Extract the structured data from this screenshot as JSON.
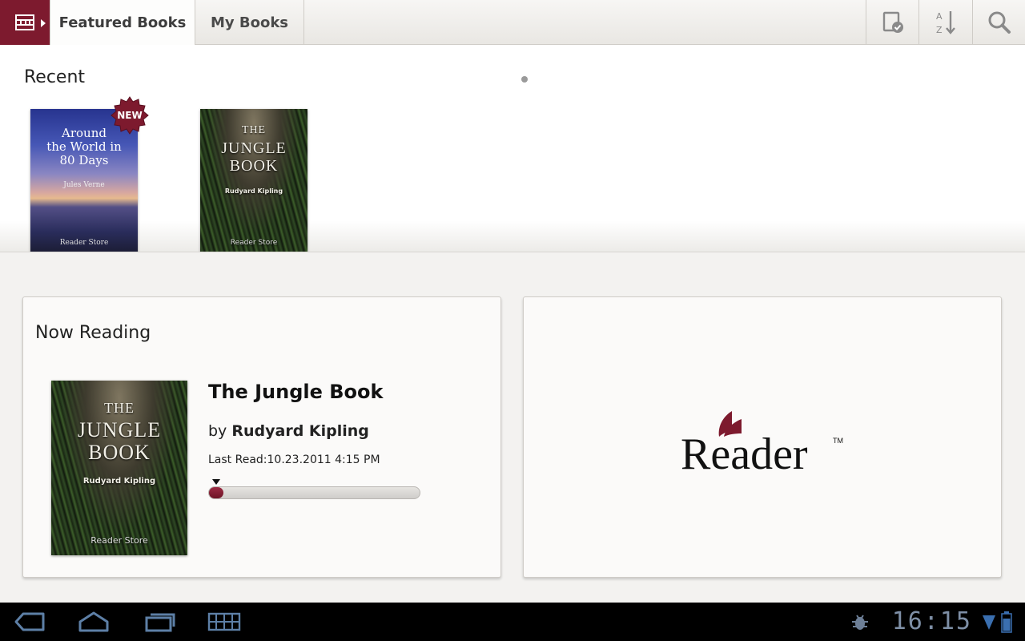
{
  "top_bar": {
    "app_menu_icon": "bookshelf-icon",
    "tabs": [
      {
        "label": "Featured Books",
        "active": true
      },
      {
        "label": "My Books",
        "active": false
      }
    ],
    "actions": [
      "select-books-icon",
      "sort-az-icon",
      "search-icon"
    ]
  },
  "recent": {
    "title": "Recent",
    "books": [
      {
        "title_lines": [
          "Around",
          "the World in",
          "80 Days"
        ],
        "author": "Jules Verne",
        "publisher": "Reader Store",
        "badge": "NEW"
      },
      {
        "title_lines": [
          "THE",
          "JUNGLE",
          "BOOK"
        ],
        "author": "Rudyard Kipling",
        "publisher": "Reader Store"
      }
    ]
  },
  "now_reading": {
    "heading": "Now Reading",
    "book_title": "The Jungle Book",
    "by_prefix": "by",
    "author": "Rudyard Kipling",
    "last_read": "Last Read:10.23.2011 4:15 PM",
    "progress_fraction": 0.04,
    "cover": {
      "title_lines": [
        "THE",
        "JUNGLE",
        "BOOK"
      ],
      "author": "Rudyard Kipling",
      "publisher": "Reader Store"
    }
  },
  "promo": {
    "logo_text": "Reader",
    "trademark": "TM",
    "brand_color": "#7d1a2e"
  },
  "system_bar": {
    "clock": "16:15",
    "buttons": [
      "back-icon",
      "home-icon",
      "recent-apps-icon",
      "menu-grid-icon"
    ],
    "status_icons": [
      "usb-debug-icon",
      "wifi-icon",
      "battery-icon"
    ]
  },
  "colors": {
    "accent": "#7d1a2e",
    "background": "#f3f2f0",
    "progress": "#8a213a"
  }
}
